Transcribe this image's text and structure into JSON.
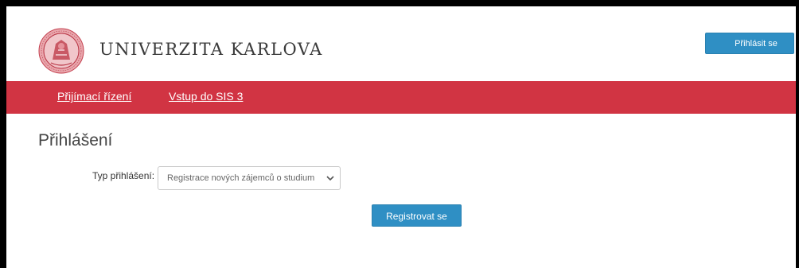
{
  "header": {
    "university_name": "UNIVERZITA KARLOVA",
    "login_button": "Přihlásit se"
  },
  "navbar": {
    "items": [
      {
        "label": "Přijímací řízení"
      },
      {
        "label": "Vstup do SIS 3"
      }
    ]
  },
  "main": {
    "title": "Přihlášení",
    "login_type_label": "Typ přihlášení:",
    "login_type_selected": "Registrace nových zájemců o studium",
    "register_button": "Registrovat se"
  },
  "colors": {
    "brand_red": "#d13443",
    "button_blue": "#2f8fc4"
  },
  "icons": {
    "logo": "univerzita-karlova-seal-icon",
    "select_arrow": "chevron-down-icon"
  }
}
